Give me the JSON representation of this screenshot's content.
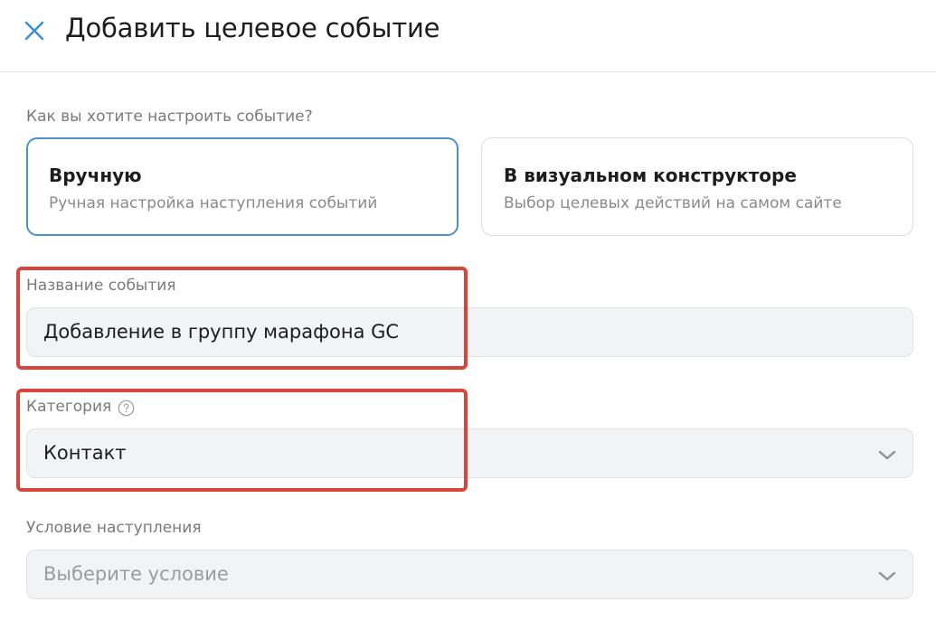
{
  "header": {
    "close_icon": "close-icon",
    "title": "Добавить целевое событие"
  },
  "setup": {
    "question": "Как вы хотите настроить событие?",
    "options": [
      {
        "title": "Вручную",
        "subtitle": "Ручная настройка наступления событий",
        "selected": true
      },
      {
        "title": "В визуальном конструкторе",
        "subtitle": "Выбор целевых действий на самом сайте",
        "selected": false
      }
    ]
  },
  "event_name": {
    "label": "Название события",
    "value": "Добавление в группу марафона GC"
  },
  "category": {
    "label": "Категория",
    "help_icon": "question-circle-icon",
    "value": "Контакт",
    "chevron_icon": "chevron-down-icon"
  },
  "condition": {
    "label": "Условие наступления",
    "placeholder": "Выберите условие",
    "chevron_icon": "chevron-down-icon"
  },
  "colors": {
    "accent": "#4a90d2",
    "annotation": "#d9443b",
    "field_bg": "#f2f3f5"
  }
}
